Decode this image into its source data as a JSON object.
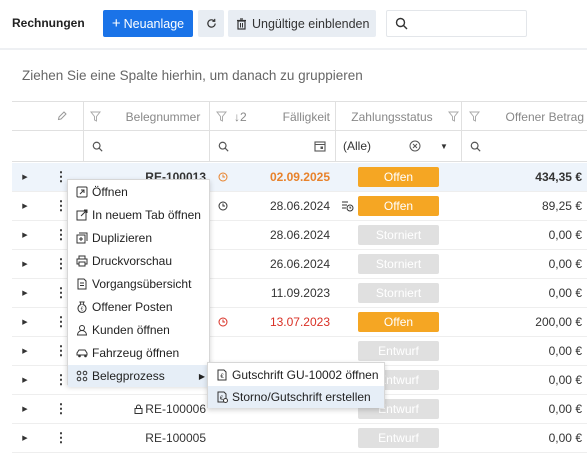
{
  "toolbar": {
    "title": "Rechnungen",
    "new_label": "Neuanlage",
    "invalid_label": "Ungültige einblenden",
    "search_placeholder": ""
  },
  "group_panel_text": "Ziehen Sie eine Spalte hierhin, um danach zu gruppieren",
  "columns": {
    "belegnummer": "Belegnummer",
    "sort_badge": "↓2",
    "faelligkeit": "Fälligkeit",
    "zahlungsstatus": "Zahlungsstatus",
    "offener_betrag": "Offener Betrag"
  },
  "filter": {
    "status_value": "(Alle)"
  },
  "rows": [
    {
      "beleg": "RE-100013",
      "faell": "02.09.2025",
      "status": "Offen",
      "betrag": "434,35 €"
    },
    {
      "beleg": "",
      "faell": "28.06.2024",
      "status": "Offen",
      "betrag": "89,25 €"
    },
    {
      "beleg": "",
      "faell": "28.06.2024",
      "status": "Storniert",
      "betrag": "0,00 €"
    },
    {
      "beleg": "",
      "faell": "26.06.2024",
      "status": "Storniert",
      "betrag": "0,00 €"
    },
    {
      "beleg": "",
      "faell": "11.09.2023",
      "status": "Storniert",
      "betrag": "0,00 €"
    },
    {
      "beleg": "",
      "faell": "13.07.2023",
      "status": "Offen",
      "betrag": "200,00 €"
    },
    {
      "beleg": "",
      "faell": "",
      "status": "Entwurf",
      "betrag": "0,00 €"
    },
    {
      "beleg": "",
      "faell": "",
      "status": "Entwurf",
      "betrag": "0,00 €"
    },
    {
      "beleg": "RE-100006",
      "faell": "",
      "status": "Entwurf",
      "betrag": "0,00 €"
    },
    {
      "beleg": "RE-100005",
      "faell": "",
      "status": "Entwurf",
      "betrag": "0,00 €"
    }
  ],
  "context_menu": [
    {
      "label": "Öffnen",
      "icon": "open-icon"
    },
    {
      "label": "In neuem Tab öffnen",
      "icon": "external-link-icon"
    },
    {
      "label": "Duplizieren",
      "icon": "duplicate-icon"
    },
    {
      "label": "Druckvorschau",
      "icon": "printer-icon"
    },
    {
      "label": "Vorgangsübersicht",
      "icon": "document-icon"
    },
    {
      "label": "Offener Posten",
      "icon": "money-bag-icon"
    },
    {
      "label": "Kunden öffnen",
      "icon": "user-icon"
    },
    {
      "label": "Fahrzeug öffnen",
      "icon": "car-icon"
    },
    {
      "label": "Belegprozess",
      "icon": "process-icon"
    }
  ],
  "submenu": [
    {
      "label": "Gutschrift GU-10002 öffnen",
      "icon": "credit-note-icon"
    },
    {
      "label": "Storno/Gutschrift erstellen",
      "icon": "credit-note-create-icon"
    }
  ],
  "colors": {
    "primary": "#1a73e8",
    "status_open": "#f5a623",
    "status_gray": "#e0e0e0",
    "due_orange": "#e8822b",
    "due_red": "#d93025"
  }
}
